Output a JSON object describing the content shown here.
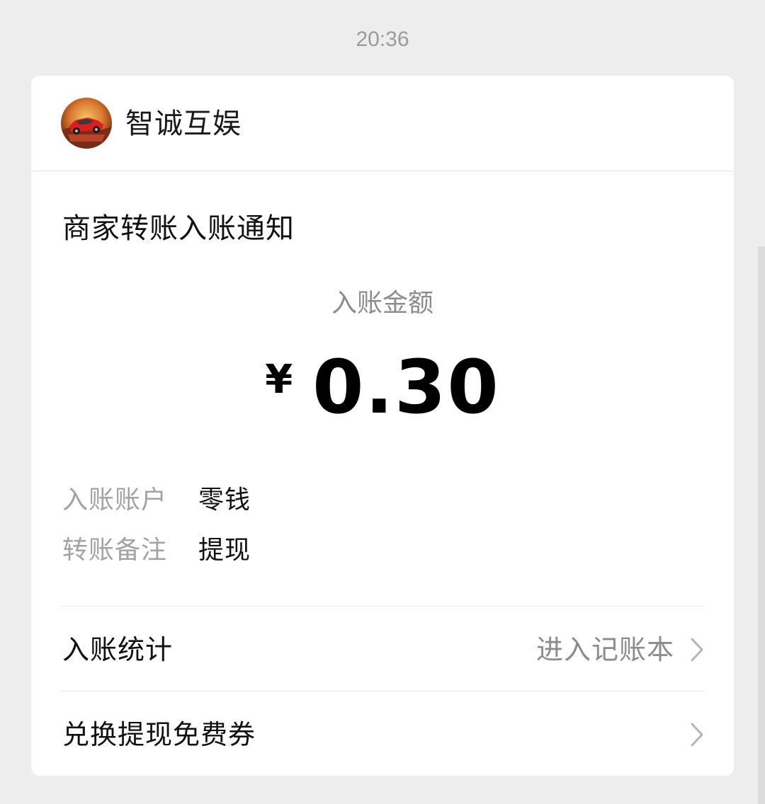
{
  "timestamp": "20:36",
  "card": {
    "merchant": {
      "name": "智诚互娱",
      "avatar_icon": "red-sports-car-avatar"
    },
    "title": "商家转账入账通知",
    "amount_label": "入账金额",
    "currency_symbol": "¥",
    "amount": "0.30",
    "details": [
      {
        "label": "入账账户",
        "value": "零钱"
      },
      {
        "label": "转账备注",
        "value": "提现"
      }
    ],
    "links": [
      {
        "label": "入账统计",
        "hint": "进入记账本",
        "icon": "chevron-right-icon"
      },
      {
        "label": "兑换提现免费券",
        "hint": "",
        "icon": "chevron-right-icon"
      }
    ]
  },
  "colors": {
    "background": "#ededed",
    "card": "#ffffff",
    "secondary_text": "#8c8c8c",
    "primary_text": "#111111"
  }
}
